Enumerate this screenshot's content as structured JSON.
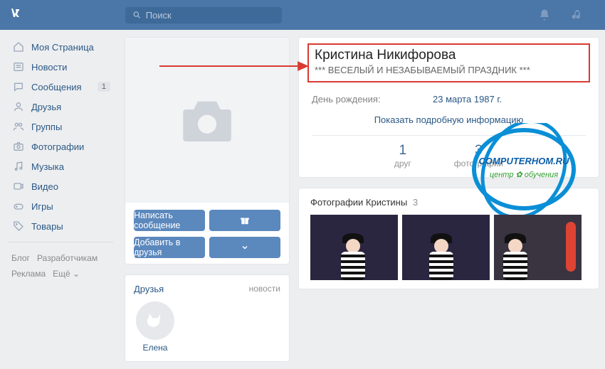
{
  "header": {
    "search_placeholder": "Поиск"
  },
  "sidebar": {
    "items": [
      {
        "label": "Моя Страница"
      },
      {
        "label": "Новости"
      },
      {
        "label": "Сообщения",
        "badge": "1"
      },
      {
        "label": "Друзья"
      },
      {
        "label": "Группы"
      },
      {
        "label": "Фотографии"
      },
      {
        "label": "Музыка"
      },
      {
        "label": "Видео"
      },
      {
        "label": "Игры"
      },
      {
        "label": "Товары"
      }
    ],
    "footer": {
      "blog": "Блог",
      "developers": "Разработчикам",
      "ads": "Реклама",
      "more": "Ещё ⌄"
    }
  },
  "actions": {
    "message": "Написать сообщение",
    "add_friend": "Добавить в друзья"
  },
  "friends": {
    "title": "Друзья",
    "news": "новости",
    "items": [
      {
        "name": "Елена"
      }
    ]
  },
  "profile": {
    "name": "Кристина Никифорова",
    "status": "*** ВЕСЕЛЫЙ И НЕЗАБЫВАЕМЫЙ ПРАЗДНИК ***",
    "birthday_label": "День рождения:",
    "birthday_value": "23 марта 1987 г.",
    "show_more": "Показать подробную информацию",
    "counters": [
      {
        "num": "1",
        "label": "друг"
      },
      {
        "num": "3",
        "label": "фотографии"
      }
    ]
  },
  "photos": {
    "title": "Фотографии Кристины",
    "count": "3"
  },
  "watermark": {
    "text": "COMPUTERHOM.RU",
    "sub": "центр ✿ обучения"
  },
  "colors": {
    "accent": "#4a76a8",
    "red": "#d93a32"
  }
}
